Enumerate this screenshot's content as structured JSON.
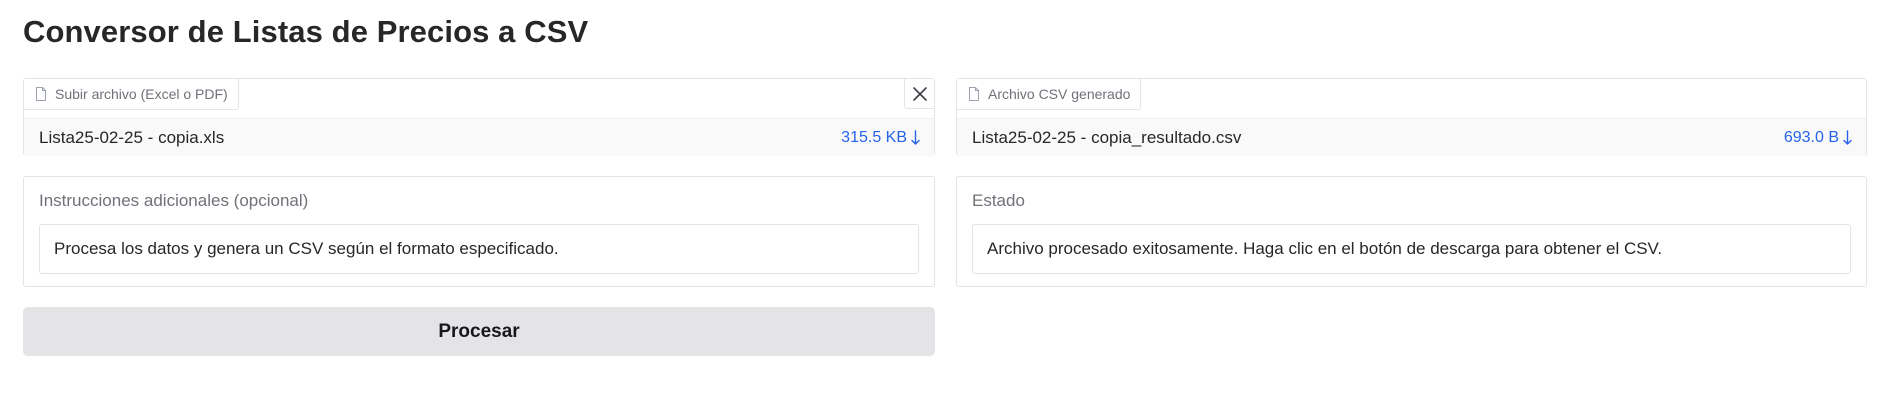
{
  "page": {
    "title": "Conversor de Listas de Precios a CSV"
  },
  "upload": {
    "label": "Subir archivo (Excel o PDF)",
    "label_icon": "file-icon",
    "file_name": "Lista25-02-25 - copia.xls",
    "file_size": "315.5 KB",
    "download_icon": "download-arrow-icon",
    "clear_icon": "close-icon"
  },
  "output": {
    "label": "Archivo CSV generado",
    "label_icon": "file-icon",
    "file_name": "Lista25-02-25 - copia_resultado.csv",
    "file_size": "693.0 B",
    "download_icon": "download-arrow-icon"
  },
  "instructions": {
    "label": "Instrucciones adicionales (opcional)",
    "value": "Procesa los datos y genera un CSV según el formato especificado."
  },
  "status": {
    "label": "Estado",
    "value": "Archivo procesado exitosamente. Haga clic en el botón de descarga para obtener el CSV."
  },
  "actions": {
    "process_label": "Procesar"
  },
  "colors": {
    "link": "#2563eb",
    "button_bg": "#e4e4e7",
    "border": "#e4e4e7",
    "muted_text": "#71717a"
  }
}
